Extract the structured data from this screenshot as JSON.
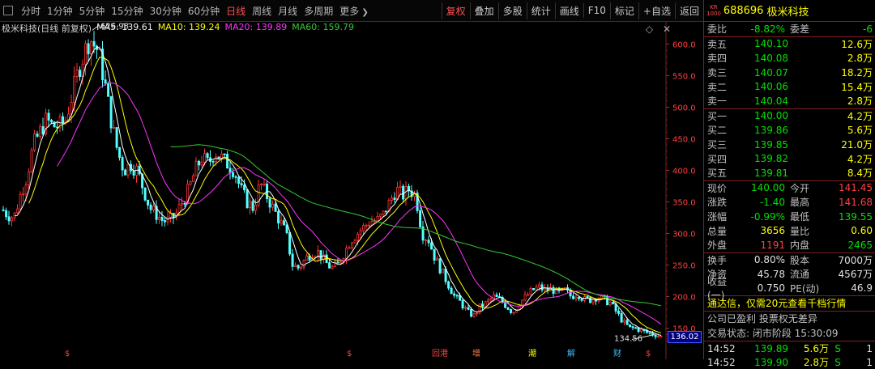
{
  "toolbar": {
    "periods": [
      {
        "label": "分时",
        "active": false
      },
      {
        "label": "1分钟",
        "active": false
      },
      {
        "label": "5分钟",
        "active": false
      },
      {
        "label": "15分钟",
        "active": false
      },
      {
        "label": "30分钟",
        "active": false
      },
      {
        "label": "60分钟",
        "active": false
      },
      {
        "label": "日线",
        "active": true
      },
      {
        "label": "周线",
        "active": false
      },
      {
        "label": "月线",
        "active": false
      },
      {
        "label": "多周期",
        "active": false
      },
      {
        "label": "更多",
        "active": false
      }
    ],
    "right_buttons": [
      {
        "label": "复权",
        "active": true
      },
      {
        "label": "叠加",
        "active": false
      },
      {
        "label": "多股",
        "active": false
      },
      {
        "label": "统计",
        "active": false
      },
      {
        "label": "画线",
        "active": false
      },
      {
        "label": "F10",
        "active": false
      },
      {
        "label": "标记",
        "active": false
      },
      {
        "label": "+自选",
        "active": false
      },
      {
        "label": "返回",
        "active": false
      }
    ]
  },
  "legend": {
    "name": "极米科技(日线 前复权)",
    "ma5": "MA5: 139.61",
    "ma10": "MA10: 139.24",
    "ma20": "MA20: 139.89",
    "ma60": "MA60: 159.79"
  },
  "chart_data": {
    "type": "candlestick",
    "y_ticks": [
      "600.0",
      "550.0",
      "500.0",
      "450.0",
      "400.0",
      "350.0",
      "300.0",
      "250.0",
      "200.0",
      "150.0"
    ],
    "ylim": [
      125,
      630
    ],
    "high_label": "626.98",
    "low_label": "134.56",
    "last_price_tag": "136.02",
    "colors": {
      "up": "#ff3232",
      "down": "#54ffff",
      "ma5": "#ffffff",
      "ma10": "#ffff00",
      "ma20": "#ff33ff",
      "ma60": "#33cc33"
    },
    "markers": [
      {
        "label": "$",
        "color": "#ff4040"
      },
      {
        "label": "$",
        "color": "#ff4040"
      },
      {
        "label": "回港",
        "color": "#ff4040"
      },
      {
        "label": "增",
        "color": "#ff8040"
      },
      {
        "label": "潮",
        "color": "#ffff00"
      },
      {
        "label": "解",
        "color": "#40c0ff"
      },
      {
        "label": "财",
        "color": "#40c0ff"
      },
      {
        "label": "$",
        "color": "#ff4040"
      }
    ],
    "trend_path": [
      [
        0,
        340
      ],
      [
        8,
        330
      ],
      [
        16,
        325
      ],
      [
        24,
        360
      ],
      [
        32,
        390
      ],
      [
        40,
        440
      ],
      [
        48,
        460
      ],
      [
        56,
        480
      ],
      [
        64,
        470
      ],
      [
        72,
        470
      ],
      [
        80,
        480
      ],
      [
        88,
        520
      ],
      [
        96,
        560
      ],
      [
        104,
        590
      ],
      [
        110,
        610
      ],
      [
        114,
        600
      ],
      [
        120,
        590
      ],
      [
        128,
        540
      ],
      [
        136,
        480
      ],
      [
        144,
        430
      ],
      [
        152,
        400
      ],
      [
        160,
        410
      ],
      [
        168,
        400
      ],
      [
        176,
        370
      ],
      [
        184,
        340
      ],
      [
        192,
        330
      ],
      [
        200,
        320
      ],
      [
        208,
        320
      ],
      [
        216,
        330
      ],
      [
        224,
        350
      ],
      [
        232,
        370
      ],
      [
        240,
        400
      ],
      [
        248,
        420
      ],
      [
        256,
        410
      ],
      [
        264,
        430
      ],
      [
        272,
        420
      ],
      [
        280,
        410
      ],
      [
        288,
        400
      ],
      [
        296,
        370
      ],
      [
        304,
        350
      ],
      [
        312,
        340
      ],
      [
        320,
        380
      ],
      [
        328,
        360
      ],
      [
        336,
        340
      ],
      [
        344,
        320
      ],
      [
        352,
        300
      ],
      [
        360,
        250
      ],
      [
        368,
        245
      ],
      [
        376,
        260
      ],
      [
        384,
        270
      ],
      [
        392,
        270
      ],
      [
        400,
        255
      ],
      [
        408,
        245
      ],
      [
        416,
        250
      ],
      [
        424,
        270
      ],
      [
        432,
        290
      ],
      [
        440,
        300
      ],
      [
        448,
        310
      ],
      [
        456,
        320
      ],
      [
        464,
        320
      ],
      [
        472,
        330
      ],
      [
        480,
        350
      ],
      [
        488,
        370
      ],
      [
        496,
        360
      ],
      [
        504,
        370
      ],
      [
        512,
        360
      ],
      [
        520,
        300
      ],
      [
        528,
        290
      ],
      [
        536,
        260
      ],
      [
        544,
        240
      ],
      [
        552,
        220
      ],
      [
        560,
        200
      ],
      [
        568,
        190
      ],
      [
        576,
        175
      ],
      [
        584,
        170
      ],
      [
        592,
        185
      ],
      [
        600,
        190
      ],
      [
        608,
        200
      ],
      [
        616,
        195
      ],
      [
        624,
        185
      ],
      [
        632,
        175
      ],
      [
        640,
        190
      ],
      [
        648,
        200
      ],
      [
        656,
        210
      ],
      [
        664,
        215
      ],
      [
        672,
        210
      ],
      [
        680,
        212
      ],
      [
        688,
        205
      ],
      [
        696,
        210
      ],
      [
        704,
        200
      ],
      [
        712,
        205
      ],
      [
        720,
        195
      ],
      [
        728,
        195
      ],
      [
        736,
        200
      ],
      [
        744,
        195
      ],
      [
        752,
        190
      ],
      [
        760,
        175
      ],
      [
        768,
        160
      ],
      [
        776,
        150
      ],
      [
        784,
        150
      ],
      [
        792,
        145
      ],
      [
        800,
        142
      ],
      [
        808,
        140
      ],
      [
        816,
        136
      ]
    ]
  },
  "panel": {
    "badge_top": "KR",
    "badge_bottom": "1000",
    "code": "688696",
    "name": "极米科技",
    "weibi": {
      "label": "委比",
      "value": "-8.82%",
      "label2": "委差",
      "value2": "-6"
    },
    "asks": [
      {
        "label": "卖五",
        "price": "140.10",
        "vol": "12.6万"
      },
      {
        "label": "卖四",
        "price": "140.08",
        "vol": "2.8万"
      },
      {
        "label": "卖三",
        "price": "140.07",
        "vol": "18.2万"
      },
      {
        "label": "卖二",
        "price": "140.06",
        "vol": "15.4万"
      },
      {
        "label": "卖一",
        "price": "140.04",
        "vol": "2.8万"
      }
    ],
    "bids": [
      {
        "label": "买一",
        "price": "140.00",
        "vol": "4.2万"
      },
      {
        "label": "买二",
        "price": "139.86",
        "vol": "5.6万"
      },
      {
        "label": "买三",
        "price": "139.85",
        "vol": "21.0万"
      },
      {
        "label": "买四",
        "price": "139.82",
        "vol": "4.2万"
      },
      {
        "label": "买五",
        "price": "139.81",
        "vol": "8.4万"
      }
    ],
    "stats1": [
      {
        "l1": "现价",
        "v1": "140.00",
        "c1": "green",
        "l2": "今开",
        "v2": "141.45",
        "c2": "red"
      },
      {
        "l1": "涨跌",
        "v1": "-1.40",
        "c1": "green",
        "l2": "最高",
        "v2": "141.68",
        "c2": "red"
      },
      {
        "l1": "涨幅",
        "v1": "-0.99%",
        "c1": "green",
        "l2": "最低",
        "v2": "139.55",
        "c2": "green"
      },
      {
        "l1": "总量",
        "v1": "3656",
        "c1": "yellow",
        "l2": "量比",
        "v2": "0.60",
        "c2": "yellow"
      },
      {
        "l1": "外盘",
        "v1": "1191",
        "c1": "red",
        "l2": "内盘",
        "v2": "2465",
        "c2": "green"
      }
    ],
    "stats2": [
      {
        "l1": "换手",
        "v1": "0.80%",
        "c1": "white",
        "l2": "股本",
        "v2": "7000万",
        "c2": "white"
      },
      {
        "l1": "净资",
        "v1": "45.78",
        "c1": "white",
        "l2": "流通",
        "v2": "4567万",
        "c2": "white"
      },
      {
        "l1": "收益(一)",
        "v1": "0.750",
        "c1": "white",
        "l2": "PE(动)",
        "v2": "46.9",
        "c2": "white"
      }
    ],
    "notice": "通达信，仅需20元查看千档行情",
    "info1": "公司已盈利 投票权无差异",
    "info2": "交易状态: 闭市阶段 15:30:09",
    "ticks": [
      {
        "time": "14:52",
        "price": "139.89",
        "vol": "5.6万",
        "side": "S",
        "n": "1"
      },
      {
        "time": "14:52",
        "price": "139.90",
        "vol": "2.8万",
        "side": "S",
        "n": "1"
      }
    ]
  }
}
